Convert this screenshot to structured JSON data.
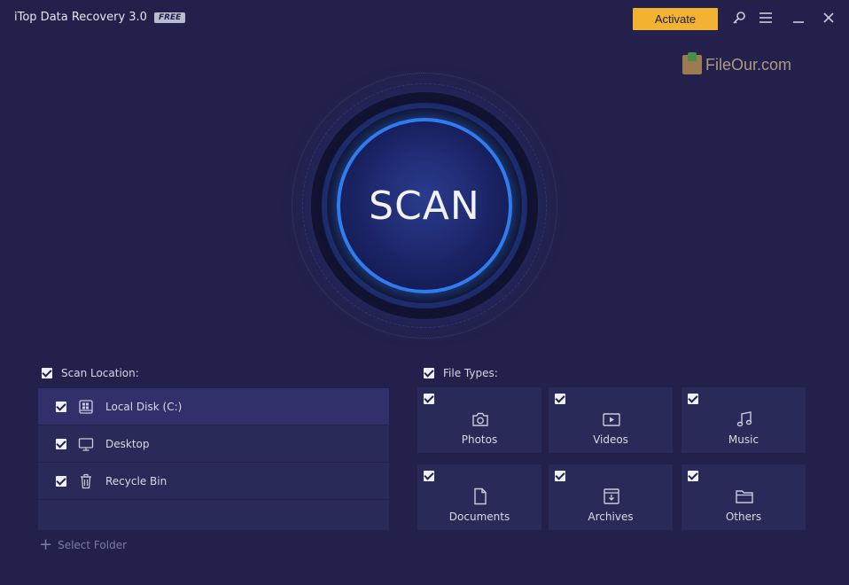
{
  "app": {
    "title": "iTop Data Recovery 3.0",
    "badge": "FREE"
  },
  "titlebar": {
    "activate_label": "Activate",
    "icons": [
      "key-icon",
      "menu-icon",
      "minimize-icon",
      "close-icon"
    ]
  },
  "watermark": {
    "text": "FileOur.com"
  },
  "scan": {
    "label": "SCAN"
  },
  "scan_location": {
    "header": "Scan Location:",
    "items": [
      {
        "label": "Local Disk (C:)",
        "icon": "disk-icon",
        "checked": true
      },
      {
        "label": "Desktop",
        "icon": "monitor-icon",
        "checked": true
      },
      {
        "label": "Recycle Bin",
        "icon": "trash-icon",
        "checked": true
      }
    ],
    "select_folder": "Select Folder"
  },
  "file_types": {
    "header": "File Types:",
    "items": [
      {
        "label": "Photos",
        "icon": "camera-icon",
        "checked": true
      },
      {
        "label": "Videos",
        "icon": "video-icon",
        "checked": true
      },
      {
        "label": "Music",
        "icon": "music-icon",
        "checked": true
      },
      {
        "label": "Documents",
        "icon": "document-icon",
        "checked": true
      },
      {
        "label": "Archives",
        "icon": "archive-icon",
        "checked": true
      },
      {
        "label": "Others",
        "icon": "folder-icon",
        "checked": true
      }
    ]
  },
  "colors": {
    "background": "#23214b",
    "panel": "#2a2a58",
    "accent": "#2f7cf0",
    "activate": "#f2b232"
  }
}
